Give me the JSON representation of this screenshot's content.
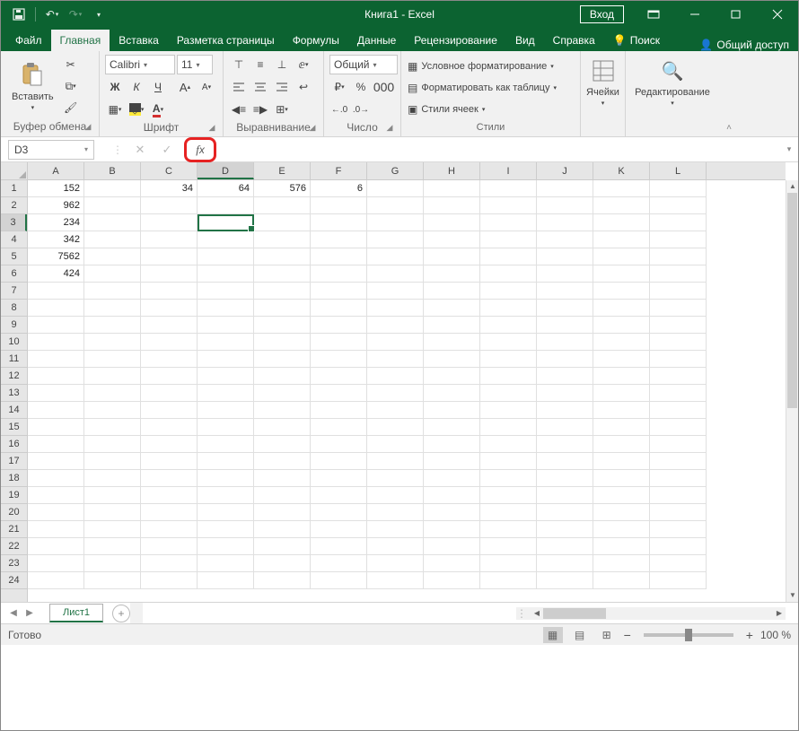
{
  "title": "Книга1  -  Excel",
  "login": "Вход",
  "tabs": {
    "file": "Файл",
    "home": "Главная",
    "insert": "Вставка",
    "layout": "Разметка страницы",
    "formulas": "Формулы",
    "data": "Данные",
    "review": "Рецензирование",
    "view": "Вид",
    "help": "Справка",
    "search": "Поиск",
    "share": "Общий доступ"
  },
  "ribbon": {
    "clipboard": {
      "title": "Буфер обмена",
      "paste": "Вставить"
    },
    "font": {
      "title": "Шрифт",
      "name": "Calibri",
      "size": "11",
      "bold": "Ж",
      "italic": "К",
      "underline": "Ч"
    },
    "align": {
      "title": "Выравнивание"
    },
    "number": {
      "title": "Число",
      "format": "Общий"
    },
    "styles": {
      "title": "Стили",
      "cond": "Условное форматирование",
      "table": "Форматировать как таблицу",
      "cell": "Стили ячеек"
    },
    "cells": {
      "title": "Ячейки"
    },
    "editing": {
      "title": "Редактирование"
    }
  },
  "namebox": "D3",
  "columns": [
    "A",
    "B",
    "C",
    "D",
    "E",
    "F",
    "G",
    "H",
    "I",
    "J",
    "K",
    "L"
  ],
  "active_col_idx": 3,
  "row_count": 24,
  "active_row": 3,
  "data_rows": [
    {
      "A": "152",
      "C": "34",
      "D": "64",
      "E": "576",
      "F": "6"
    },
    {
      "A": "962"
    },
    {
      "A": "234"
    },
    {
      "A": "342"
    },
    {
      "A": "7562"
    },
    {
      "A": "424"
    }
  ],
  "sheet_tab": "Лист1",
  "status": "Готово",
  "zoom": "100 %"
}
